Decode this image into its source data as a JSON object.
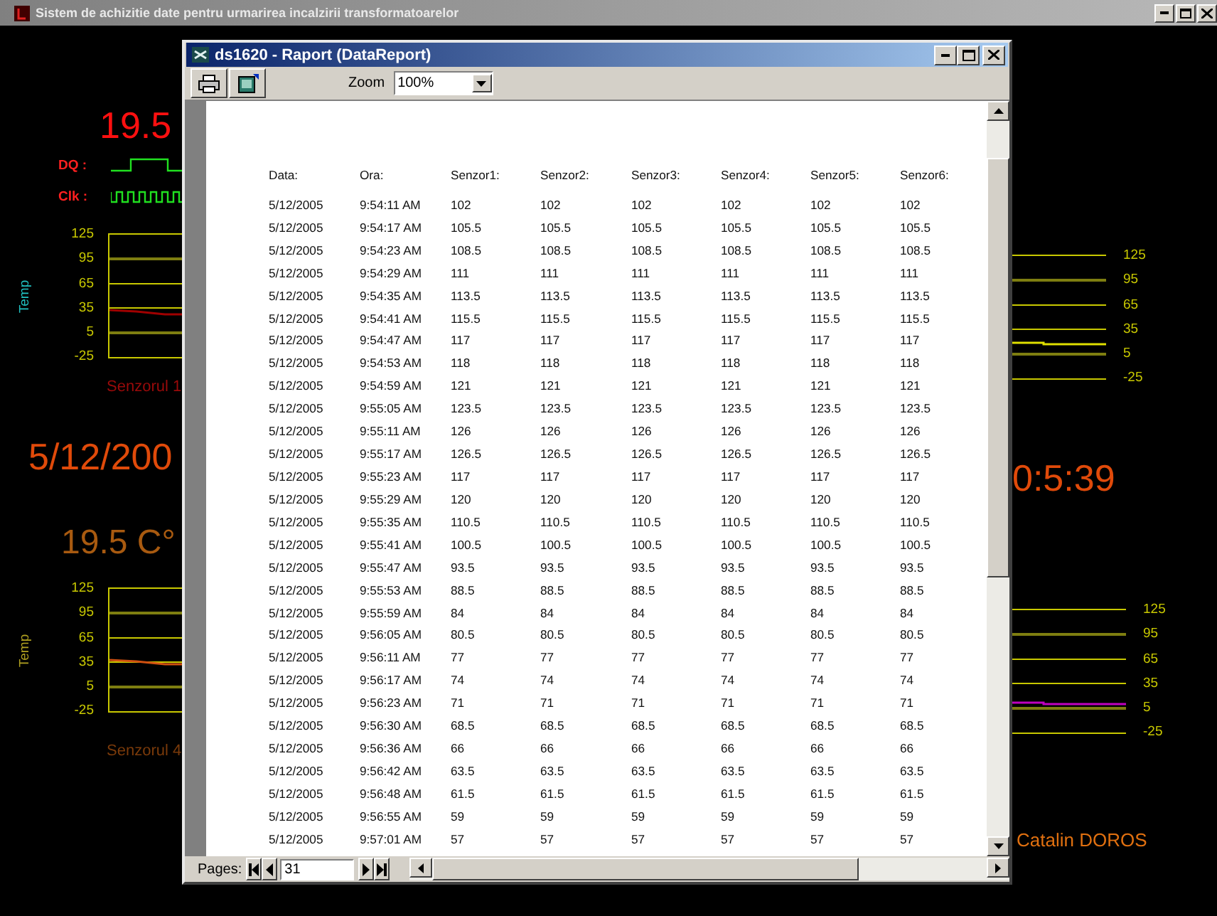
{
  "window": {
    "title": "Sistem de achizitie date pentru urmarirea incalzirii transformatoarelor"
  },
  "left_panel": {
    "temperature_1": "19.5",
    "signals": [
      {
        "label": "DQ :",
        "kind": "data"
      },
      {
        "label": "Clk :",
        "kind": "clock"
      }
    ],
    "chart_1": {
      "y_title": "Temp",
      "ticks": [
        "125",
        "95",
        "65",
        "35",
        "5",
        "-25"
      ],
      "caption": "Senzorul 1"
    },
    "date": "5/12/200",
    "temperature_2": "19.5 C°",
    "chart_2": {
      "y_title": "Temp",
      "ticks": [
        "125",
        "95",
        "65",
        "35",
        "5",
        "-25"
      ],
      "caption": "Senzorul 4"
    }
  },
  "right_panel": {
    "chart_1": {
      "ticks": [
        "125",
        "95",
        "65",
        "35",
        "5",
        "-25"
      ]
    },
    "time": "0:5:39",
    "chart_2": {
      "ticks": [
        "125",
        "95",
        "65",
        "35",
        "5",
        "-25"
      ]
    },
    "author": "Catalin DOROS"
  },
  "report_window": {
    "title": "ds1620 - Raport (DataReport)",
    "toolbar": {
      "zoom_label": "Zoom",
      "zoom_value": "100%"
    },
    "table": {
      "columns": [
        "Data:",
        "Ora:",
        "Senzor1:",
        "Senzor2:",
        "Senzor3:",
        "Senzor4:",
        "Senzor5:",
        "Senzor6:"
      ],
      "rows": [
        {
          "date": "5/12/2005",
          "time": "9:54:11 AM",
          "values": [
            "102",
            "102",
            "102",
            "102",
            "102",
            "102"
          ]
        },
        {
          "date": "5/12/2005",
          "time": "9:54:17 AM",
          "values": [
            "105.5",
            "105.5",
            "105.5",
            "105.5",
            "105.5",
            "105.5"
          ]
        },
        {
          "date": "5/12/2005",
          "time": "9:54:23 AM",
          "values": [
            "108.5",
            "108.5",
            "108.5",
            "108.5",
            "108.5",
            "108.5"
          ]
        },
        {
          "date": "5/12/2005",
          "time": "9:54:29 AM",
          "values": [
            "111",
            "111",
            "111",
            "111",
            "111",
            "111"
          ]
        },
        {
          "date": "5/12/2005",
          "time": "9:54:35 AM",
          "values": [
            "113.5",
            "113.5",
            "113.5",
            "113.5",
            "113.5",
            "113.5"
          ]
        },
        {
          "date": "5/12/2005",
          "time": "9:54:41 AM",
          "values": [
            "115.5",
            "115.5",
            "115.5",
            "115.5",
            "115.5",
            "115.5"
          ]
        },
        {
          "date": "5/12/2005",
          "time": "9:54:47 AM",
          "values": [
            "117",
            "117",
            "117",
            "117",
            "117",
            "117"
          ]
        },
        {
          "date": "5/12/2005",
          "time": "9:54:53 AM",
          "values": [
            "118",
            "118",
            "118",
            "118",
            "118",
            "118"
          ]
        },
        {
          "date": "5/12/2005",
          "time": "9:54:59 AM",
          "values": [
            "121",
            "121",
            "121",
            "121",
            "121",
            "121"
          ]
        },
        {
          "date": "5/12/2005",
          "time": "9:55:05 AM",
          "values": [
            "123.5",
            "123.5",
            "123.5",
            "123.5",
            "123.5",
            "123.5"
          ]
        },
        {
          "date": "5/12/2005",
          "time": "9:55:11 AM",
          "values": [
            "126",
            "126",
            "126",
            "126",
            "126",
            "126"
          ]
        },
        {
          "date": "5/12/2005",
          "time": "9:55:17 AM",
          "values": [
            "126.5",
            "126.5",
            "126.5",
            "126.5",
            "126.5",
            "126.5"
          ]
        },
        {
          "date": "5/12/2005",
          "time": "9:55:23 AM",
          "values": [
            "117",
            "117",
            "117",
            "117",
            "117",
            "117"
          ]
        },
        {
          "date": "5/12/2005",
          "time": "9:55:29 AM",
          "values": [
            "120",
            "120",
            "120",
            "120",
            "120",
            "120"
          ]
        },
        {
          "date": "5/12/2005",
          "time": "9:55:35 AM",
          "values": [
            "110.5",
            "110.5",
            "110.5",
            "110.5",
            "110.5",
            "110.5"
          ]
        },
        {
          "date": "5/12/2005",
          "time": "9:55:41 AM",
          "values": [
            "100.5",
            "100.5",
            "100.5",
            "100.5",
            "100.5",
            "100.5"
          ]
        },
        {
          "date": "5/12/2005",
          "time": "9:55:47 AM",
          "values": [
            "93.5",
            "93.5",
            "93.5",
            "93.5",
            "93.5",
            "93.5"
          ]
        },
        {
          "date": "5/12/2005",
          "time": "9:55:53 AM",
          "values": [
            "88.5",
            "88.5",
            "88.5",
            "88.5",
            "88.5",
            "88.5"
          ]
        },
        {
          "date": "5/12/2005",
          "time": "9:55:59 AM",
          "values": [
            "84",
            "84",
            "84",
            "84",
            "84",
            "84"
          ]
        },
        {
          "date": "5/12/2005",
          "time": "9:56:05 AM",
          "values": [
            "80.5",
            "80.5",
            "80.5",
            "80.5",
            "80.5",
            "80.5"
          ]
        },
        {
          "date": "5/12/2005",
          "time": "9:56:11 AM",
          "values": [
            "77",
            "77",
            "77",
            "77",
            "77",
            "77"
          ]
        },
        {
          "date": "5/12/2005",
          "time": "9:56:17 AM",
          "values": [
            "74",
            "74",
            "74",
            "74",
            "74",
            "74"
          ]
        },
        {
          "date": "5/12/2005",
          "time": "9:56:23 AM",
          "values": [
            "71",
            "71",
            "71",
            "71",
            "71",
            "71"
          ]
        },
        {
          "date": "5/12/2005",
          "time": "9:56:30 AM",
          "values": [
            "68.5",
            "68.5",
            "68.5",
            "68.5",
            "68.5",
            "68.5"
          ]
        },
        {
          "date": "5/12/2005",
          "time": "9:56:36 AM",
          "values": [
            "66",
            "66",
            "66",
            "66",
            "66",
            "66"
          ]
        },
        {
          "date": "5/12/2005",
          "time": "9:56:42 AM",
          "values": [
            "63.5",
            "63.5",
            "63.5",
            "63.5",
            "63.5",
            "63.5"
          ]
        },
        {
          "date": "5/12/2005",
          "time": "9:56:48 AM",
          "values": [
            "61.5",
            "61.5",
            "61.5",
            "61.5",
            "61.5",
            "61.5"
          ]
        },
        {
          "date": "5/12/2005",
          "time": "9:56:55 AM",
          "values": [
            "59",
            "59",
            "59",
            "59",
            "59",
            "59"
          ]
        },
        {
          "date": "5/12/2005",
          "time": "9:57:01 AM",
          "values": [
            "57",
            "57",
            "57",
            "57",
            "57",
            "57"
          ]
        }
      ]
    },
    "pager": {
      "label": "Pages:",
      "page": "31"
    }
  }
}
